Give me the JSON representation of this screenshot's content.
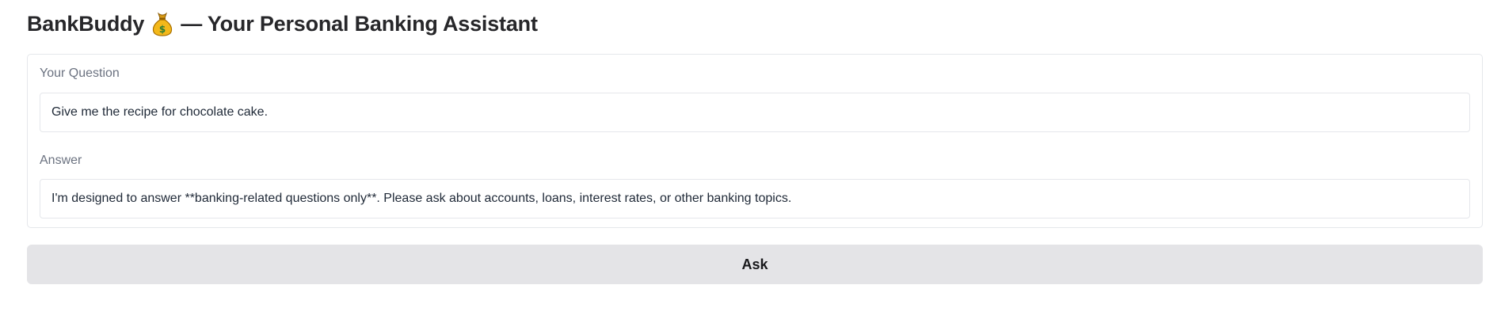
{
  "header": {
    "title_prefix": "BankBuddy",
    "title_icon": "money-bag-icon",
    "title_suffix": "— Your Personal Banking Assistant"
  },
  "question": {
    "label": "Your Question",
    "value": "Give me the recipe for chocolate cake."
  },
  "answer": {
    "label": "Answer",
    "value": "I'm designed to answer **banking-related questions only**. Please ask about accounts, loans, interest rates, or other banking topics."
  },
  "actions": {
    "ask_label": "Ask"
  },
  "colors": {
    "button_bg": "#e4e4e7",
    "border": "#e5e7eb",
    "label_text": "#6b7280"
  }
}
